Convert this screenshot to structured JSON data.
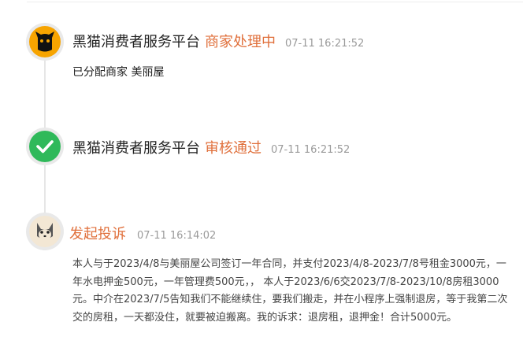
{
  "timeline": {
    "event1": {
      "source": "黑猫消费者服务平台",
      "status": "商家处理中",
      "time": "07-11 16:21:52",
      "detail": "已分配商家 美丽屋"
    },
    "event2": {
      "source": "黑猫消费者服务平台",
      "status": "审核通过",
      "time": "07-11 16:21:52"
    },
    "event3": {
      "title": "发起投诉",
      "time": "07-11 16:14:02",
      "body": "本人与于2023/4/8与美丽屋公司签订一年合同，并支付2023/4/8-2023/7/8号租金3000元，一年水电押金500元，一年管理费500元，， 本人于2023/6/6交2023/7/8-2023/10/8房租3000元。中介在2023/7/5告知我们不能继续住，要我们搬走，并在小程序上强制退房，等于我第二次交的房租，一天都没住，就要被迫搬离。我的诉求：退房租，退押金！合计5000元。"
    }
  },
  "colors": {
    "accent_orange": "#e0703c",
    "muted_time": "#9a9a9a",
    "check_green": "#2fb95a",
    "cat_yellow": "#f7a400"
  },
  "icons": {
    "event1": "black-cat-logo-icon",
    "event2": "check-circle-icon",
    "event3": "user-avatar-icon"
  }
}
